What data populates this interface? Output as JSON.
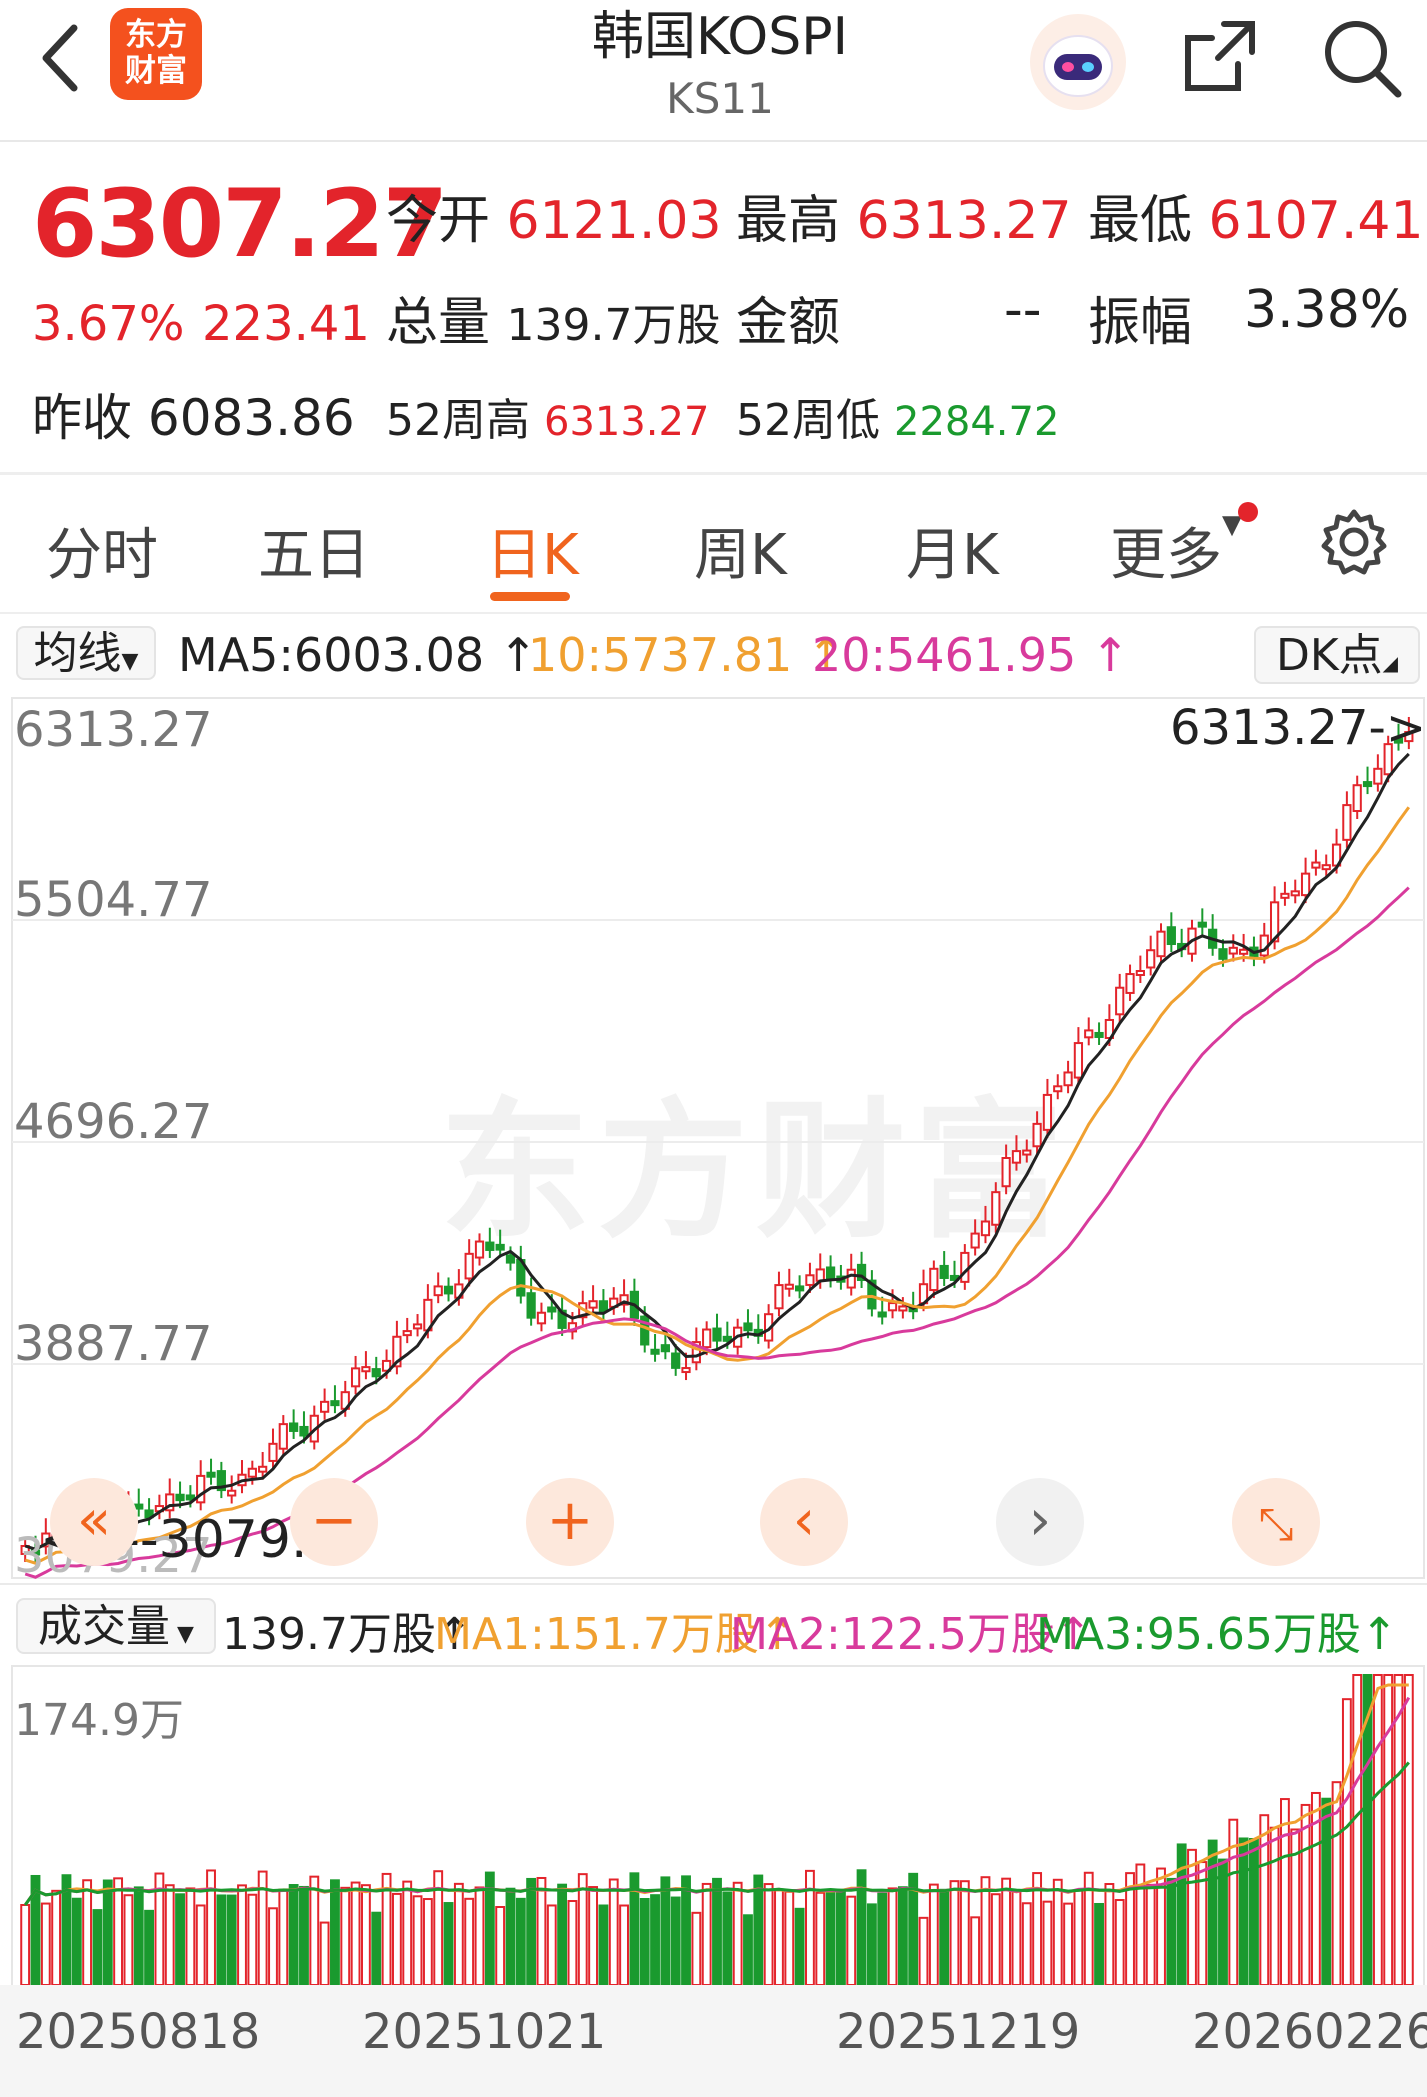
{
  "header": {
    "title": "韩国KOSPI",
    "code": "KS11",
    "logo_line1": "东方",
    "logo_line2": "财富"
  },
  "quote": {
    "price": "6307.27",
    "change_pct": "3.67%",
    "change_amt": "223.41",
    "open_label": "今开",
    "open": "6121.03",
    "high_label": "最高",
    "high": "6313.27",
    "low_label": "最低",
    "low": "6107.41",
    "volume_label": "总量",
    "volume": "139.7万股",
    "amount_label": "金额",
    "amount": "--",
    "amplitude_label": "振幅",
    "amplitude": "3.38%",
    "prev_close_label": "昨收",
    "prev_close": "6083.86",
    "w52_high_label": "52周高",
    "w52_high": "6313.27",
    "w52_low_label": "52周低",
    "w52_low": "2284.72"
  },
  "tabs": [
    {
      "label": "分时",
      "active": false
    },
    {
      "label": "五日",
      "active": false
    },
    {
      "label": "日K",
      "active": true
    },
    {
      "label": "周K",
      "active": false
    },
    {
      "label": "月K",
      "active": false
    },
    {
      "label": "更多",
      "active": false
    }
  ],
  "ma_legend": {
    "select": "均线",
    "ma5": "MA5:6003.08 ↑",
    "ma10": "10:5737.81 ↑",
    "ma20": "20:5461.95 ↑",
    "dk_button": "DK点"
  },
  "price_axis": [
    "6313.27",
    "5504.77",
    "4696.27",
    "3887.77",
    "3079.27"
  ],
  "high_marker": "6313.27->",
  "low_marker": "<----3079.27",
  "watermark": "东方财富",
  "volume_legend": {
    "select": "成交量",
    "current": "139.7万股↑",
    "ma1": "MA1:151.7万股↑",
    "ma2": "MA2:122.5万股↑",
    "ma3": "MA3:95.65万股↑",
    "max": "174.9万"
  },
  "dates": [
    "20250818",
    "20251021",
    "20251219",
    "20260226"
  ],
  "colors": {
    "up": "#e3242b",
    "down": "#1a9a2e",
    "ma5": "#222222",
    "ma10": "#f0a030",
    "ma20": "#d83a9c",
    "accent": "#f0641e"
  },
  "icons": {
    "back": "chevron-left-icon",
    "share": "share-icon",
    "search": "search-icon",
    "settings": "gear-icon",
    "robot": "robot-icon"
  }
}
